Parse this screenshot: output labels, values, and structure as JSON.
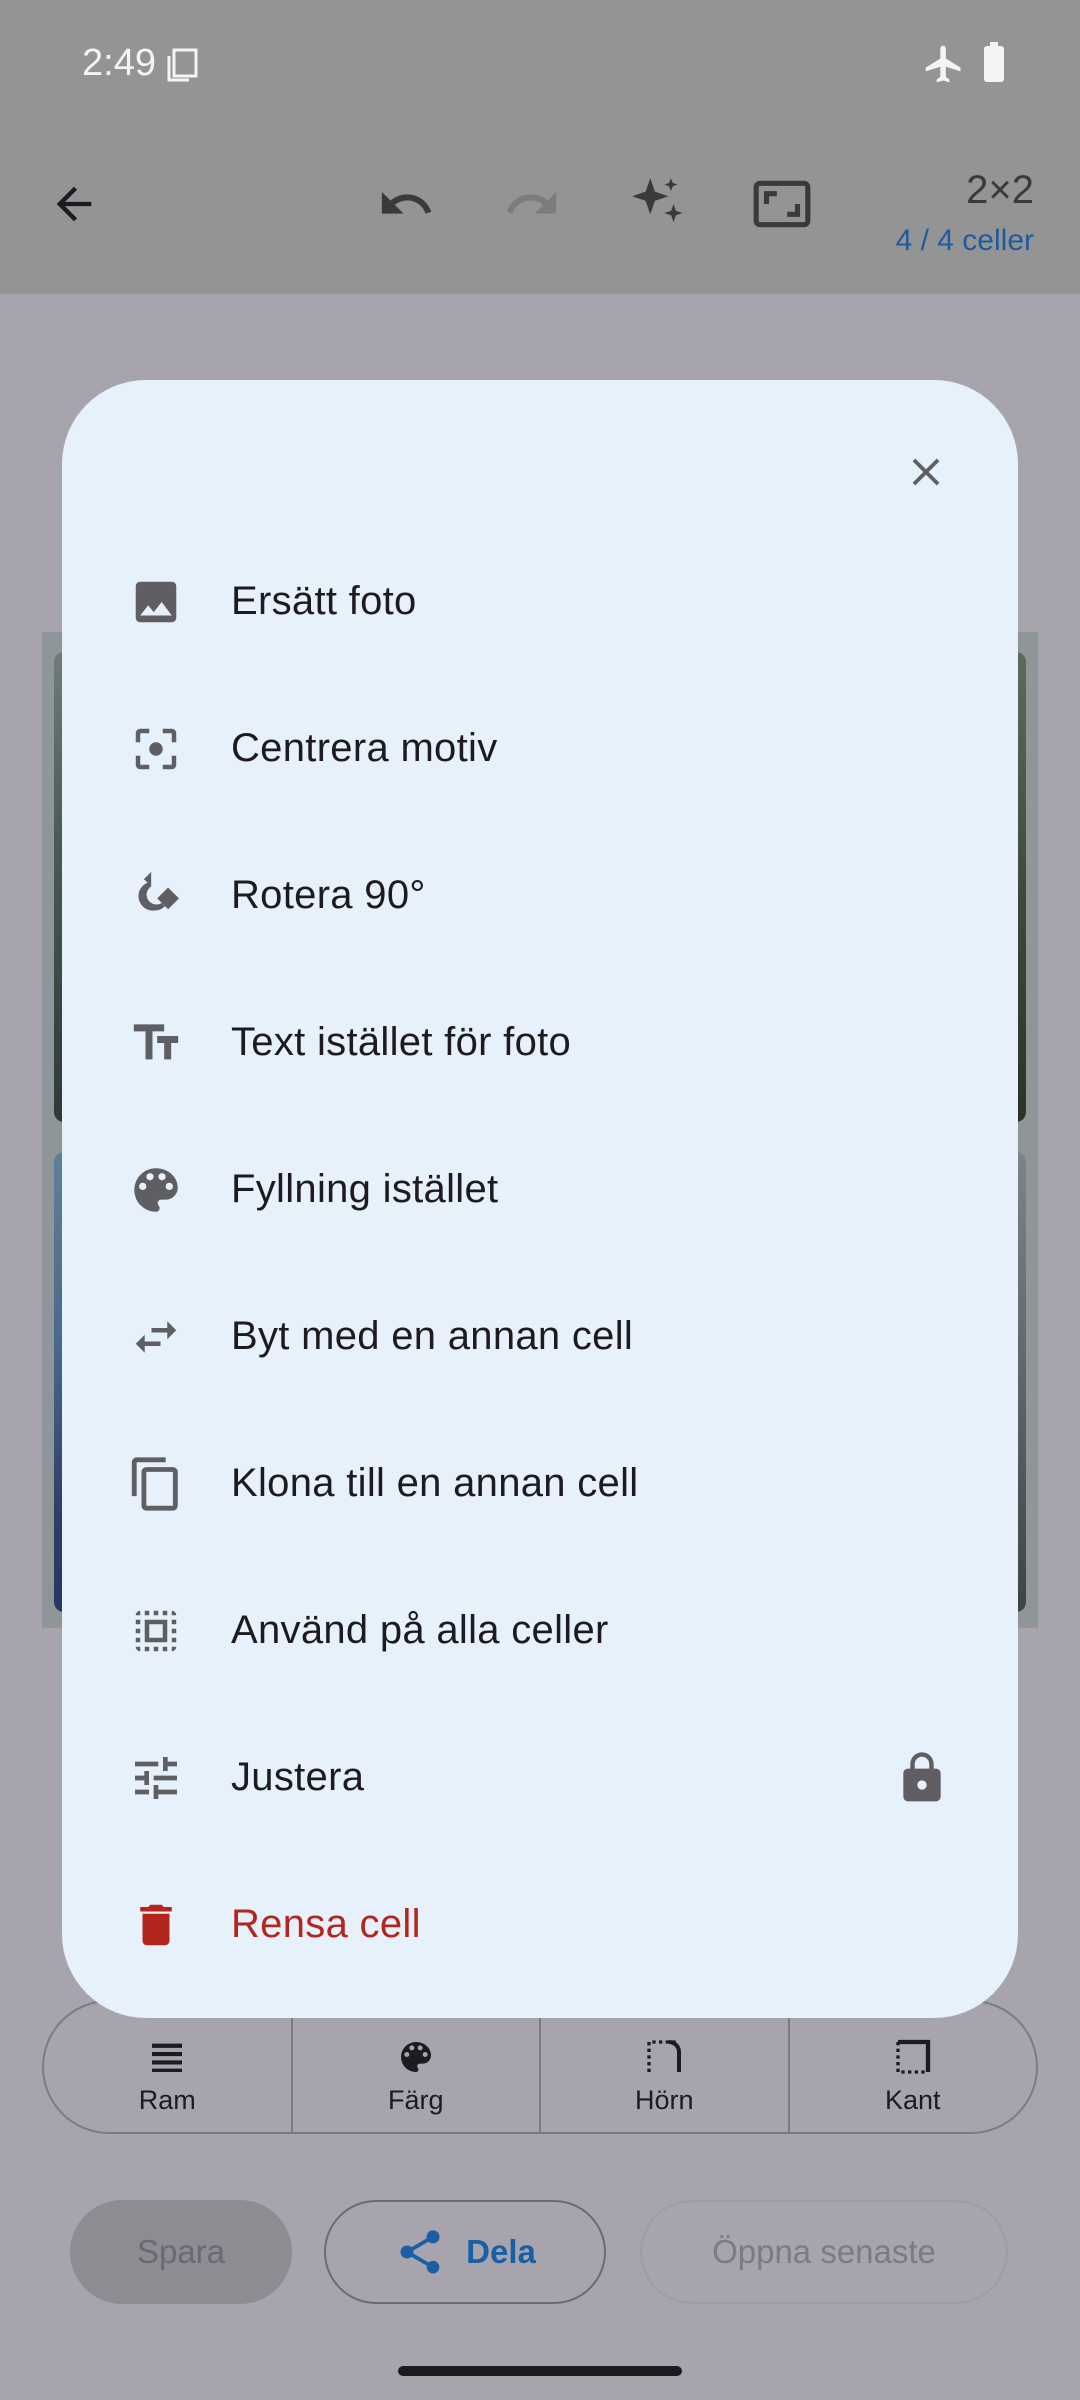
{
  "status": {
    "time": "2:49"
  },
  "toolbar": {
    "grid_size": "2×2",
    "cells_count": "4 / 4 celler"
  },
  "segments": [
    {
      "label": "Ram",
      "icon": "ram-icon"
    },
    {
      "label": "Färg",
      "icon": "palette-icon"
    },
    {
      "label": "Hörn",
      "icon": "corner-icon"
    },
    {
      "label": "Kant",
      "icon": "border-icon"
    }
  ],
  "buttons": {
    "save": "Spara",
    "share": "Dela",
    "open_recent": "Öppna senaste"
  },
  "menu": {
    "items": [
      {
        "label": "Ersätt foto",
        "icon": "image-icon"
      },
      {
        "label": "Centrera motiv",
        "icon": "center-focus-icon"
      },
      {
        "label": "Rotera 90°",
        "icon": "rotate-icon"
      },
      {
        "label": "Text istället för foto",
        "icon": "text-icon"
      },
      {
        "label": "Fyllning istället",
        "icon": "palette-icon"
      },
      {
        "label": "Byt med en annan cell",
        "icon": "swap-icon"
      },
      {
        "label": "Klona till en annan cell",
        "icon": "copy-icon"
      },
      {
        "label": "Använd på alla celler",
        "icon": "select-all-icon"
      },
      {
        "label": "Justera",
        "icon": "tune-icon",
        "locked": true
      },
      {
        "label": "Rensa cell",
        "icon": "delete-icon",
        "danger": true
      }
    ]
  },
  "colors": {
    "sheet_bg": "#e6f1fb",
    "accent": "#1a5fa4",
    "danger": "#b3261e",
    "scrim": "#a7a4ad"
  }
}
